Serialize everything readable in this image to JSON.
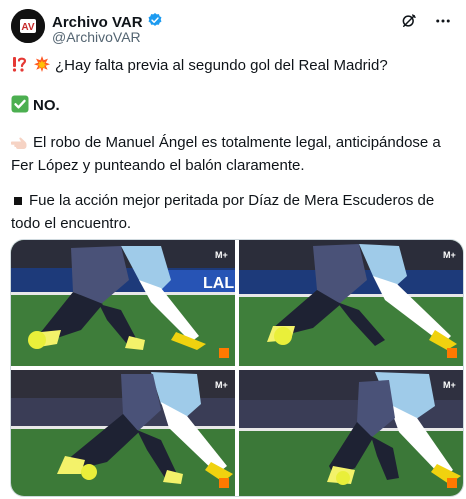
{
  "author": {
    "name": "Archivo VAR",
    "handle": "@ArchivoVAR",
    "avatar_text": "AV"
  },
  "tweet": {
    "line1": "¿Hay falta previa al segundo gol del Real Madrid?",
    "line2": "NO.",
    "line3": "El robo de Manuel Ángel es totalmente legal, anticipándose a Fer López y punteando el balón claramente.",
    "line4": "Fue la acción mejor peritada por Díaz de Mera Escuderos de todo el encuentro."
  },
  "media": {
    "watermark": "M+",
    "banner_text": "LALIGA"
  },
  "icons": {
    "verified": "verified-badge-icon",
    "grok": "grok-icon",
    "more": "more-icon",
    "alert": "exclamation-question-icon",
    "collision": "collision-icon",
    "check": "check-mark-icon",
    "point": "pointing-hand-icon",
    "square": "square-bullet-icon"
  },
  "colors": {
    "verified": "#1d9bf0",
    "check_green": "#4caf50",
    "pitch": "#3e7d3a"
  }
}
